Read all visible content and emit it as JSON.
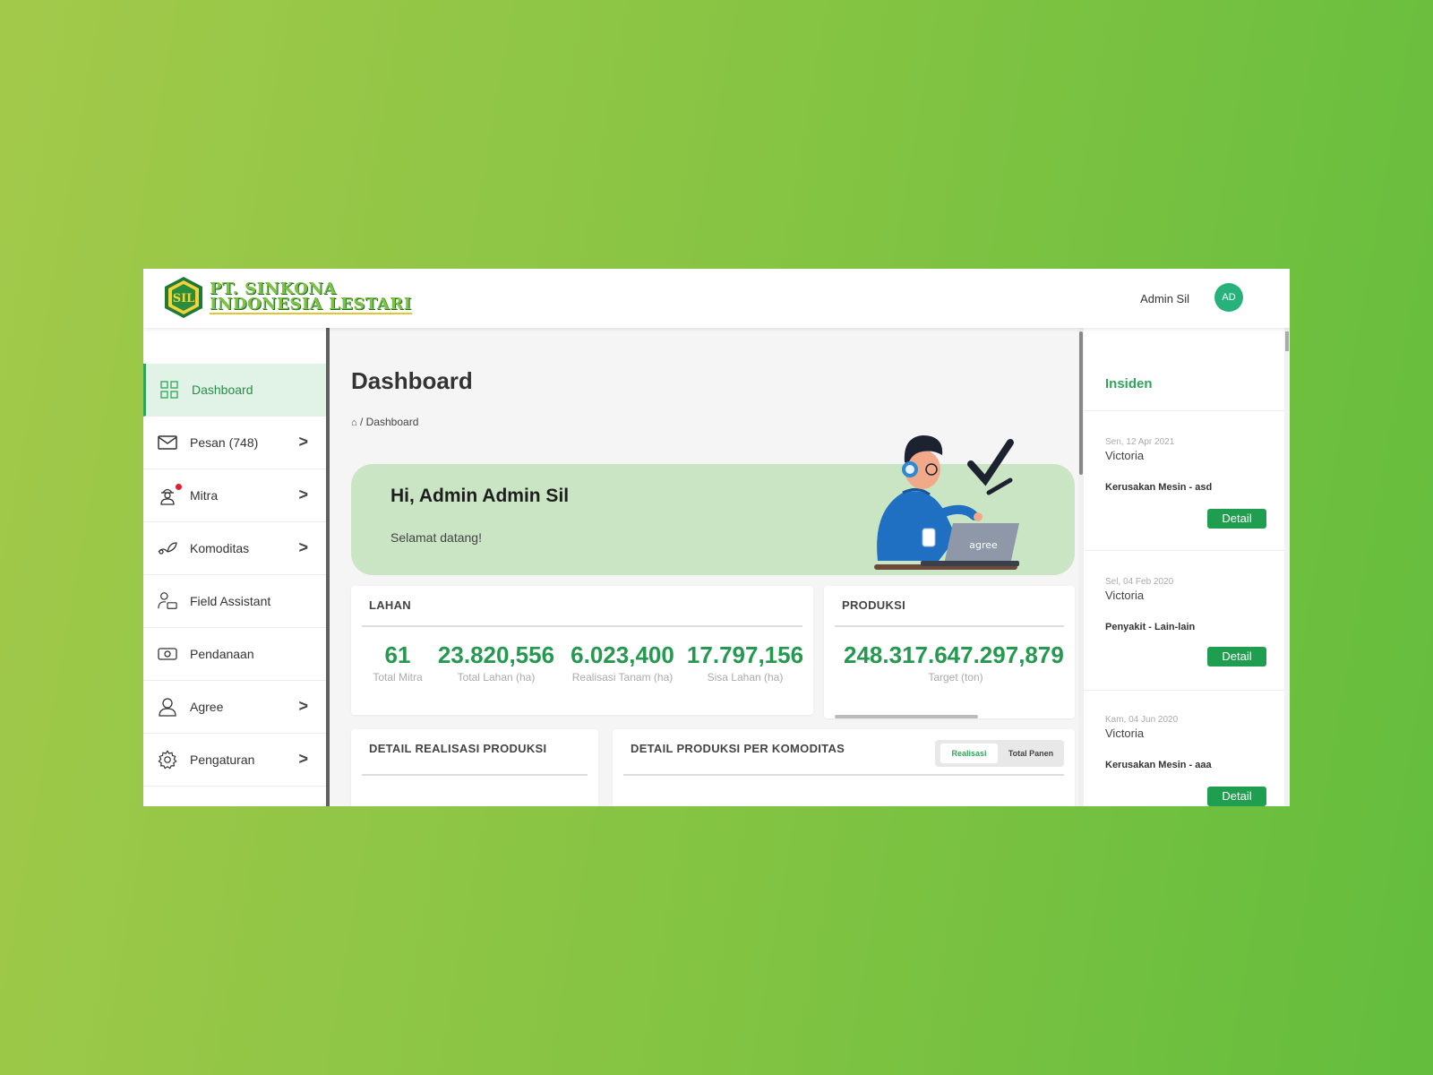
{
  "brand": {
    "badge_text": "SIL",
    "line1": "PT. SINKONA",
    "line2": "INDONESIA LESTARI",
    "primary_color": "#2ea55a",
    "background_gradient": [
      "#a3c94a",
      "#64bd3d"
    ]
  },
  "header": {
    "user_name": "Admin Sil",
    "avatar_initials": "AD"
  },
  "sidebar": {
    "items": [
      {
        "label": "Dashboard",
        "icon": "grid-icon",
        "active": true,
        "chevron": false
      },
      {
        "label": "Pesan (748)",
        "icon": "mail-icon",
        "active": false,
        "chevron": true
      },
      {
        "label": "Mitra",
        "icon": "farmer-icon",
        "active": false,
        "chevron": true,
        "notification_dot": true
      },
      {
        "label": "Komoditas",
        "icon": "sprout-icon",
        "active": false,
        "chevron": true
      },
      {
        "label": "Field Assistant",
        "icon": "user-chat-icon",
        "active": false,
        "chevron": false
      },
      {
        "label": "Pendanaan",
        "icon": "money-icon",
        "active": false,
        "chevron": false
      },
      {
        "label": "Agree",
        "icon": "user-icon",
        "active": false,
        "chevron": true
      },
      {
        "label": "Pengaturan",
        "icon": "gear-icon",
        "active": false,
        "chevron": true
      }
    ],
    "chevron_glyph": ">"
  },
  "main": {
    "title": "Dashboard",
    "breadcrumb": "/ Dashboard",
    "banner": {
      "greeting": "Hi, Admin Admin Sil",
      "subtitle": "Selamat datang!",
      "laptop_text": "agree"
    },
    "lahan": {
      "title": "LAHAN",
      "stats": [
        {
          "value": "61",
          "label": "Total Mitra"
        },
        {
          "value": "23.820,556",
          "label": "Total Lahan (ha)"
        },
        {
          "value": "6.023,400",
          "label": "Realisasi Tanam (ha)"
        },
        {
          "value": "17.797,156",
          "label": "Sisa Lahan (ha)"
        }
      ]
    },
    "produksi": {
      "title": "PRODUKSI",
      "value": "248.317.647.297,879",
      "label": "Target (ton)"
    },
    "detail_realisasi": {
      "title": "DETAIL REALISASI PRODUKSI"
    },
    "detail_komoditas": {
      "title": "DETAIL PRODUKSI PER KOMODITAS",
      "toggle": {
        "selected": "Realisasi",
        "other": "Total Panen"
      }
    }
  },
  "insiden": {
    "title": "Insiden",
    "button_label": "Detail",
    "items": [
      {
        "date": "Sen, 12 Apr 2021",
        "name": "Victoria",
        "desc": "Kerusakan Mesin - asd"
      },
      {
        "date": "Sel, 04 Feb 2020",
        "name": "Victoria",
        "desc": "Penyakit - Lain-lain"
      },
      {
        "date": "Kam, 04 Jun 2020",
        "name": "Victoria",
        "desc": "Kerusakan Mesin - aaa"
      }
    ]
  }
}
